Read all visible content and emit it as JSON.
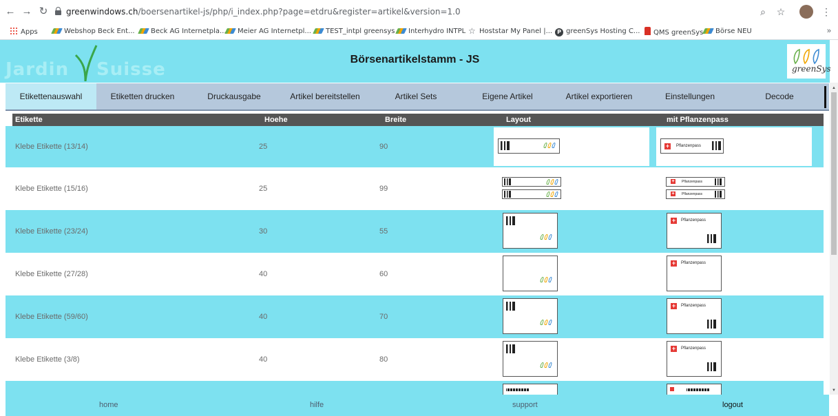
{
  "browser": {
    "url_host": "greenwindows.ch",
    "url_path": "/boersenartikel-js/php/i_index.php?page=etdru&register=artikel&version=1.0",
    "bookmarks": [
      {
        "label": "Apps",
        "icon": "apps-grid-icon"
      },
      {
        "label": "Webshop Beck Ent...",
        "icon": "greensys-icon"
      },
      {
        "label": "Beck AG Internetpla...",
        "icon": "greensys-icon"
      },
      {
        "label": "Meier AG Internetpl...",
        "icon": "greensys-icon"
      },
      {
        "label": "TEST_intpl greensys",
        "icon": "greensys-icon"
      },
      {
        "label": "Interhydro INTPL",
        "icon": "greensys-icon"
      },
      {
        "label": "Hoststar My Panel |...",
        "icon": "star-outline-icon"
      },
      {
        "label": "greenSys Hosting C...",
        "icon": "p-circle-icon"
      },
      {
        "label": "QMS greenSys",
        "icon": "qms-icon"
      },
      {
        "label": "Börse NEU",
        "icon": "greensys-icon"
      }
    ],
    "more": "»"
  },
  "header": {
    "title": "Börsenartikelstamm - JS",
    "logo_left_word1": "Jardin",
    "logo_left_word2": "Suisse",
    "logo_right_text": "greenSys"
  },
  "tabs": [
    {
      "label": "Etikettenauswahl",
      "active": true
    },
    {
      "label": "Etiketten drucken",
      "active": false
    },
    {
      "label": "Druckausgabe",
      "active": false
    },
    {
      "label": "Artikel bereitstellen",
      "active": false
    },
    {
      "label": "Artikel Sets",
      "active": false
    },
    {
      "label": "Eigene Artikel",
      "active": false
    },
    {
      "label": "Artikel exportieren",
      "active": false
    },
    {
      "label": "Einstellungen",
      "active": false
    },
    {
      "label": "Decode",
      "active": false
    }
  ],
  "table": {
    "columns": [
      "Etikette",
      "Hoehe",
      "Breite",
      "Layout",
      "mit Pflanzenpass"
    ],
    "rows": [
      {
        "name": "Klebe Etikette (13/14)",
        "hoehe": "25",
        "breite": "90",
        "style": "cyan",
        "layout": "wide"
      },
      {
        "name": "Klebe Etikette (15/16)",
        "hoehe": "25",
        "breite": "99",
        "style": "white",
        "layout": "double"
      },
      {
        "name": "Klebe Etikette (23/24)",
        "hoehe": "30",
        "breite": "55",
        "style": "cyan",
        "layout": "box"
      },
      {
        "name": "Klebe Etikette (27/28)",
        "hoehe": "40",
        "breite": "60",
        "style": "white",
        "layout": "box-noqr"
      },
      {
        "name": "Klebe Etikette (59/60)",
        "hoehe": "40",
        "breite": "70",
        "style": "cyan",
        "layout": "box"
      },
      {
        "name": "Klebe Etikette (3/8)",
        "hoehe": "40",
        "breite": "80",
        "style": "white",
        "layout": "box"
      },
      {
        "name": "",
        "hoehe": "",
        "breite": "",
        "style": "cyan",
        "layout": "bar"
      }
    ],
    "pflanzenpass_label": "Pflanzenpass"
  },
  "footer": {
    "home": "home",
    "hilfe": "hilfe",
    "support": "support",
    "logout": "logout"
  },
  "colors": {
    "accent_cyan": "#7de1f0",
    "tab_bar": "#b5c8dc",
    "header_dark": "#555555"
  }
}
